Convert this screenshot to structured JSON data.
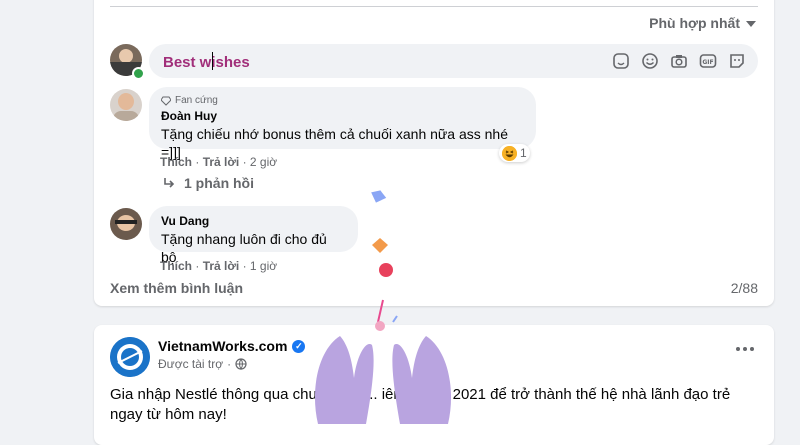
{
  "comments_section": {
    "sort_label": "Phù hợp nhất",
    "comment_input": {
      "value": "Best wishes"
    },
    "comments": [
      {
        "badge": "Fan cứng",
        "author": "Đoàn Huy",
        "text": "Tặng chiếu nhớ bonus thêm cả chuối xanh nữa ass nhé =]]]",
        "like_label": "Thích",
        "reply_label": "Trả lời",
        "time": "2 giờ",
        "reaction_count": "1",
        "replies_label": "1 phản hồi"
      },
      {
        "author": "Vu Dang",
        "text": "Tặng nhang luôn đi cho đủ bộ",
        "like_label": "Thích",
        "reply_label": "Trả lời",
        "time": "1 giờ"
      }
    ],
    "view_more_label": "Xem thêm bình luận",
    "page_count": "2/88"
  },
  "post": {
    "page_name": "VietnamWorks.com",
    "sponsored_label": "Được tài trợ",
    "text": "Gia nhập Nestlé thông qua chươ... Qu... iên tập sự 2021 để trở thành thế hệ nhà lãnh đạo trẻ ngay từ hôm nay!"
  },
  "icons": {
    "sort": "chevron-down-icon",
    "sticker": "sticker-icon",
    "emoji": "emoji-icon",
    "camera": "camera-icon",
    "gif": "gif-icon",
    "avatar_sticker": "avatar-sticker-icon",
    "diamond": "diamond-icon",
    "reply_arrow": "reply-arrow-icon",
    "verified": "verified-icon",
    "globe": "globe-icon",
    "more": "more-options-icon"
  },
  "colors": {
    "background": "#f0f2f5",
    "card": "#ffffff",
    "secondary_text": "#65676b",
    "input_text": "#a12f7a",
    "brand_blue": "#1877f2",
    "hands": "#b9a4e0"
  }
}
